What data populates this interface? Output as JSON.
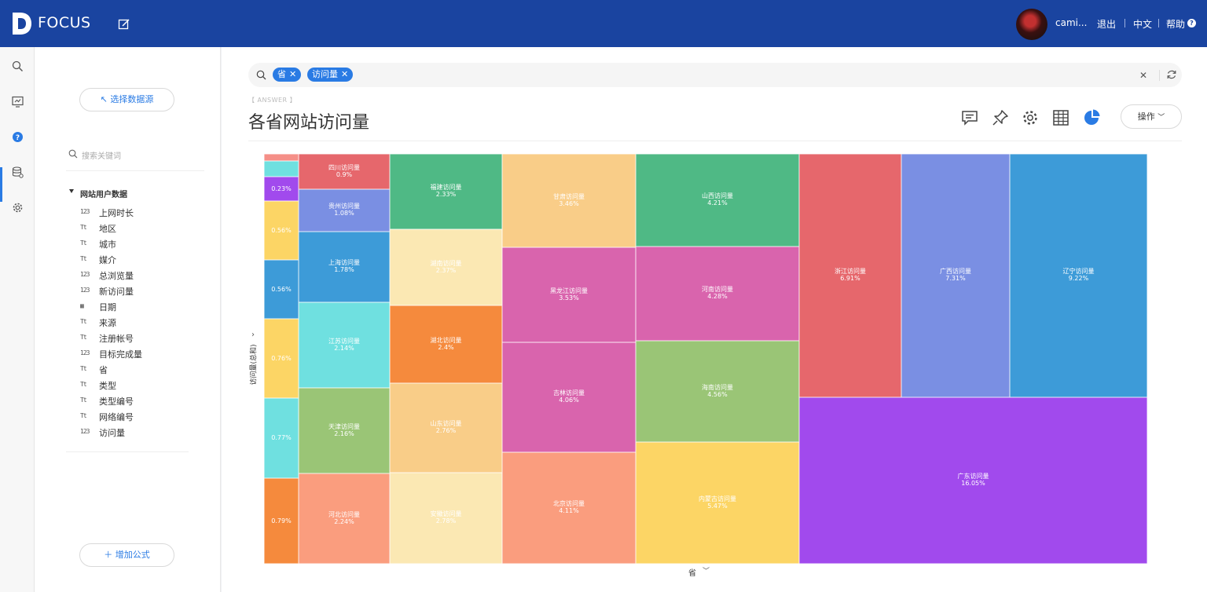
{
  "app": {
    "brand": "FOCUS",
    "user": "cami...",
    "links": {
      "logout": "退出",
      "lang": "中文",
      "help": "帮助"
    }
  },
  "rail": {
    "items": [
      "search",
      "board",
      "question",
      "data",
      "settings"
    ]
  },
  "sidebar": {
    "select_source": "↖ 选择数据源",
    "search_placeholder": "搜索关键词",
    "dataset": "网站用户数据",
    "fields": [
      {
        "icon": "measure",
        "label": "上网时长"
      },
      {
        "icon": "text",
        "label": "地区"
      },
      {
        "icon": "text",
        "label": "城市"
      },
      {
        "icon": "text",
        "label": "媒介"
      },
      {
        "icon": "measure",
        "label": "总浏览量"
      },
      {
        "icon": "measure",
        "label": "新访问量"
      },
      {
        "icon": "date",
        "label": "日期"
      },
      {
        "icon": "text",
        "label": "来源"
      },
      {
        "icon": "text",
        "label": "注册帐号"
      },
      {
        "icon": "measure",
        "label": "目标完成量"
      },
      {
        "icon": "text",
        "label": "省"
      },
      {
        "icon": "text",
        "label": "类型"
      },
      {
        "icon": "text",
        "label": "类型编号"
      },
      {
        "icon": "text",
        "label": "网络编号"
      },
      {
        "icon": "measure",
        "label": "访问量"
      }
    ],
    "add_formula": "＋ 增加公式"
  },
  "search": {
    "tokens": [
      {
        "label": "省"
      },
      {
        "label": "访问量"
      }
    ]
  },
  "answer": {
    "tag": "【 ANSWER 】",
    "title": "各省网站访问量",
    "ops": "操作"
  },
  "chart_data": {
    "type": "treemap",
    "size_measure": "访问量",
    "group_by": "省",
    "y_label": "访问量(总和)",
    "x_label": "省",
    "series_label_suffix": "访问量",
    "items": [
      {
        "name": "",
        "value": 0.1,
        "label": ""
      },
      {
        "name": "",
        "value": 0.15,
        "label": ""
      },
      {
        "name": "",
        "value": 0.23,
        "label": "0.23%"
      },
      {
        "name": "",
        "value": 0.56,
        "label": "0.56%"
      },
      {
        "name": "",
        "value": 0.56,
        "label": "0.56%"
      },
      {
        "name": "",
        "value": 0.76,
        "label": "0.76%"
      },
      {
        "name": "",
        "value": 0.77,
        "label": "0.77%"
      },
      {
        "name": "",
        "value": 0.79,
        "label": "0.79%"
      },
      {
        "name": "四川访问量",
        "value": 0.9,
        "label": "0.9%"
      },
      {
        "name": "贵州访问量",
        "value": 1.08,
        "label": "1.08%"
      },
      {
        "name": "上海访问量",
        "value": 1.78,
        "label": "1.78%"
      },
      {
        "name": "江苏访问量",
        "value": 2.14,
        "label": "2.14%"
      },
      {
        "name": "天津访问量",
        "value": 2.16,
        "label": "2.16%"
      },
      {
        "name": "河北访问量",
        "value": 2.24,
        "label": "2.24%"
      },
      {
        "name": "福建访问量",
        "value": 2.33,
        "label": "2.33%"
      },
      {
        "name": "湖南访问量",
        "value": 2.37,
        "label": "2.37%"
      },
      {
        "name": "湖北访问量",
        "value": 2.4,
        "label": "2.4%"
      },
      {
        "name": "山东访问量",
        "value": 2.76,
        "label": "2.76%"
      },
      {
        "name": "安徽访问量",
        "value": 2.78,
        "label": "2.78%"
      },
      {
        "name": "甘肃访问量",
        "value": 3.46,
        "label": "3.46%"
      },
      {
        "name": "黑龙江访问量",
        "value": 3.53,
        "label": "3.53%"
      },
      {
        "name": "吉林访问量",
        "value": 4.06,
        "label": "4.06%"
      },
      {
        "name": "北京访问量",
        "value": 4.11,
        "label": "4.11%"
      },
      {
        "name": "山西访问量",
        "value": 4.21,
        "label": "4.21%"
      },
      {
        "name": "河南访问量",
        "value": 4.28,
        "label": "4.28%"
      },
      {
        "name": "海南访问量",
        "value": 4.56,
        "label": "4.56%"
      },
      {
        "name": "内蒙古访问量",
        "value": 5.47,
        "label": "5.47%"
      },
      {
        "name": "浙江访问量",
        "value": 6.91,
        "label": "6.91%"
      },
      {
        "name": "广西访问量",
        "value": 7.31,
        "label": "7.31%"
      },
      {
        "name": "辽宁访问量",
        "value": 9.22,
        "label": "9.22%"
      },
      {
        "name": "广东访问量",
        "value": 16.05,
        "label": "16.05%"
      }
    ]
  },
  "colors": {
    "topbar": "#1a44a0",
    "accent": "#2a7be4",
    "tiles": {
      "coral": "#f58f88",
      "cyan": "#6fe0e0",
      "purple": "#a14aed",
      "yellow": "#fcd565",
      "blue": "#3d9bd8",
      "orange": "#f58a3d",
      "red": "#e6676c",
      "periwinkle": "#7a8fe3",
      "green": "#9ac576",
      "salmon": "#fa9d7e",
      "teal": "#4fb985",
      "cream": "#fbe8b3",
      "peach": "#f9cd88",
      "magenta": "#d964ad",
      "violet": "#a14aed"
    }
  }
}
